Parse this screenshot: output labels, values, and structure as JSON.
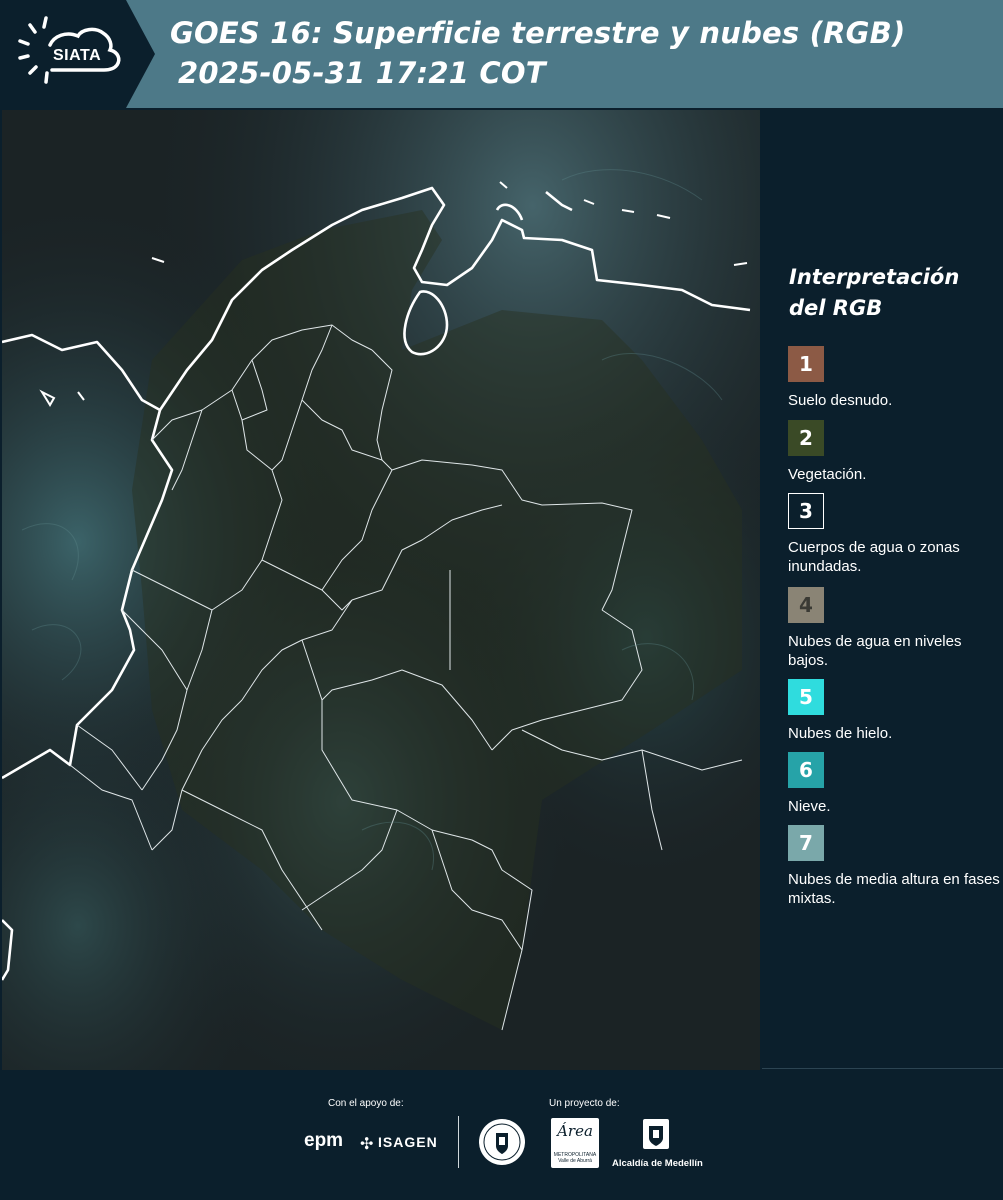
{
  "header": {
    "logo_text": "SIATA",
    "title_line1": "GOES 16: Superficie terrestre y nubes (RGB)",
    "title_line2": "2025-05-31 17:21 COT"
  },
  "legend": {
    "title": "Interpretación del RGB",
    "items": [
      {
        "number": "1",
        "label": "Suelo desnudo.",
        "color": "#8c5a45"
      },
      {
        "number": "2",
        "label": "Vegetación.",
        "color": "#3a4a26"
      },
      {
        "number": "3",
        "label": "Cuerpos de agua o zonas inundadas.",
        "color": "#0b1f2c"
      },
      {
        "number": "4",
        "label": "Nubes de agua en niveles bajos.",
        "color": "#8a8475"
      },
      {
        "number": "5",
        "label": "Nubes de hielo.",
        "color": "#2fdcde"
      },
      {
        "number": "6",
        "label": "Nieve.",
        "color": "#26a3a8"
      },
      {
        "number": "7",
        "label": "Nubes de media altura en fases mixtas.",
        "color": "#7aa8aa"
      }
    ]
  },
  "footer": {
    "support_label": "Con el apoyo de:",
    "project_label": "Un proyecto de:",
    "epm": "epm",
    "isagen": "ISAGEN",
    "area_name": "Área",
    "area_sub": "METROPOLITANA Valle de Aburrá",
    "alcaldia": "Alcaldía de Medellín"
  },
  "colors": {
    "header_bg": "#4d7988",
    "logo_bg": "#0b1f2c",
    "panel_bg": "#0b1f2c",
    "map_bg": "#141a1c"
  }
}
